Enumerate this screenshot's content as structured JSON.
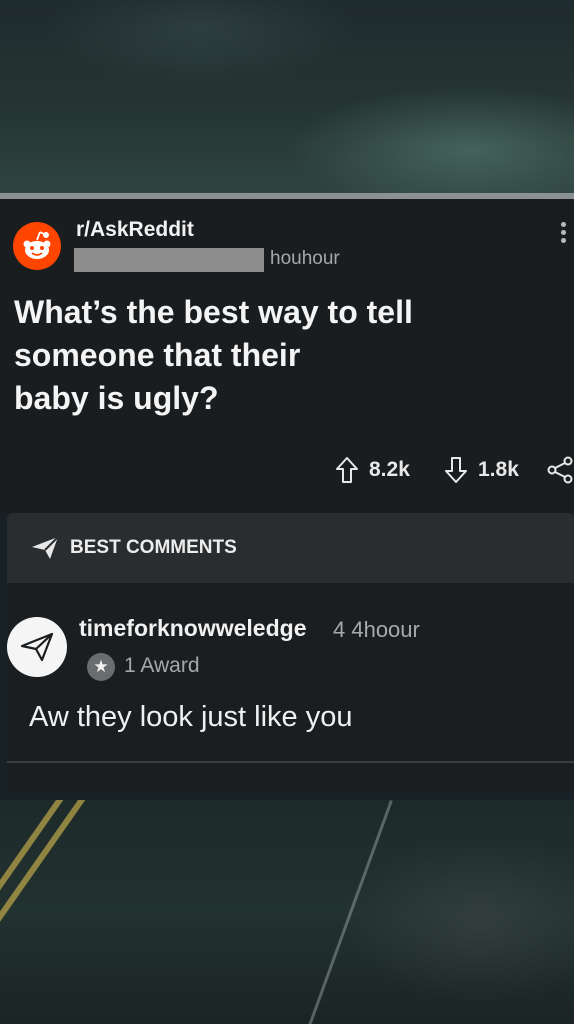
{
  "post": {
    "subreddit": "r/AskReddit",
    "time": "houhour",
    "title_lines": [
      "What’s the best way to tell",
      "someone that their",
      "baby is ugly?"
    ],
    "upvotes": "8.2k",
    "downvotes": "1.8k"
  },
  "comments": {
    "header": "BEST COMMENTS",
    "items": [
      {
        "username": "timeforknowweledge",
        "time": "4 4hoour",
        "award": "1 Award",
        "body": "Aw they look just like you"
      }
    ]
  },
  "colors": {
    "reddit_orange": "#ff4500",
    "card_bg": "#1a1d1f",
    "header_bg": "#2a2d30"
  },
  "icons": [
    "reddit-snoo-icon",
    "kebab-menu-icon",
    "upvote-icon",
    "downvote-icon",
    "share-icon",
    "paper-plane-icon",
    "star-icon"
  ]
}
